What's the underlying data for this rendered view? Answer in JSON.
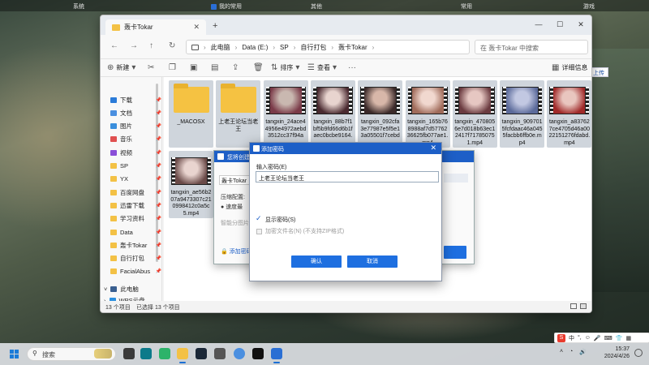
{
  "topbar": {
    "left": "系统",
    "center": "我的常用",
    "mid": "其他",
    "right1": "常用",
    "right2": "游戏"
  },
  "edge_tab": "上传",
  "window": {
    "tab_title": "轰卡Tokar",
    "addr": [
      "此电脑",
      "Data (E:)",
      "SP",
      "自行打包",
      "轰卡Tokar"
    ],
    "search_placeholder": "在 轰卡Tokar 中搜索",
    "cmd": {
      "new": "新建",
      "sort": "排序",
      "view": "查看",
      "details": "详细信息"
    },
    "sidebar": [
      {
        "label": "下载",
        "color": "#2b7bd8"
      },
      {
        "label": "文档",
        "color": "#4a8fe0"
      },
      {
        "label": "图片",
        "color": "#3a8fdd"
      },
      {
        "label": "音乐",
        "color": "#e05050"
      },
      {
        "label": "视频",
        "color": "#8a4fd8"
      },
      {
        "label": "SP",
        "color": "#f3c145"
      },
      {
        "label": "YX",
        "color": "#f3c145"
      },
      {
        "label": "百度网盘",
        "color": "#f3c145"
      },
      {
        "label": "迅雷下载",
        "color": "#f3c145"
      },
      {
        "label": "学习资料",
        "color": "#f3c145"
      },
      {
        "label": "Data",
        "color": "#f3c145"
      },
      {
        "label": "轰卡Tokar",
        "color": "#f3c145"
      },
      {
        "label": "自行打包",
        "color": "#f3c145"
      },
      {
        "label": "FacialAbus",
        "color": "#f3c145"
      }
    ],
    "sidebar_bottom": [
      {
        "label": "此电脑"
      },
      {
        "label": "WPS云盘"
      }
    ],
    "files": [
      {
        "name": "_MACOSX",
        "kind": "folder"
      },
      {
        "name": "上老王论坛当老王",
        "kind": "folder"
      },
      {
        "name": "tangxin_24ace44956e4972aebd3512cc37f94a",
        "kind": "video",
        "c1": "#c9b8b0",
        "c2": "#7a3a48"
      },
      {
        "name": "tangxin_88b7f1bf5b9fd66d6b1faec0bcbe9164.",
        "kind": "video",
        "c1": "#e8d4cf",
        "c2": "#4a2a30"
      },
      {
        "name": "tangxin_092cfa3e77987e5f5e13a05501f7cebd",
        "kind": "video",
        "c1": "#d8b7a9",
        "c2": "#3b2a2a"
      },
      {
        "name": "tangxin_165b768988af7d5776236625fb077ae1.mp4",
        "kind": "video",
        "c1": "#f1d8cf",
        "c2": "#a06b5a"
      },
      {
        "name": "tangxin_4708056e7d018b63ec12417f71785075 1.mp4",
        "kind": "video",
        "c1": "#e6c7c2",
        "c2": "#6b3b40"
      },
      {
        "name": "tangxin_9097015fcfdaac46a0455facbb6ffb0e.mp4",
        "kind": "video",
        "c1": "#c2c8e2",
        "c2": "#5b6a9a"
      },
      {
        "name": "tangxin_a837627ce4705d46a0022151276fdabd.mp4",
        "kind": "video",
        "c1": "#e9c6bf",
        "c2": "#a02a2a"
      },
      {
        "name": "tangxin_ae56b207a9473307c210998412c0a5c5.mp4",
        "kind": "video",
        "c1": "#e9d4cf",
        "c2": "#6a4a48"
      }
    ],
    "status_count": "13 个项目",
    "status_selected": "已选择 13 个项目"
  },
  "dlg_back": {
    "title": "您将创建...",
    "input_value": "轰卡Tokar",
    "compress_label": "压缩配置:",
    "speed_opt": "速度最",
    "split_label": "智能分图片",
    "add_pwd": "添加密码"
  },
  "dlg": {
    "title": "添加密码",
    "label": "输入密码(E)",
    "password": "上老王论坛当老王",
    "show_pwd": "显示密码(S)",
    "encrypt_names": "加密文件名(N) (不支持ZIP格式)",
    "ok": "确认",
    "cancel": "取消"
  },
  "taskbar": {
    "search": "搜索",
    "time": "15:37",
    "date": "2024/4/26"
  },
  "ime": {
    "lang": "中",
    "punct": "°,"
  }
}
